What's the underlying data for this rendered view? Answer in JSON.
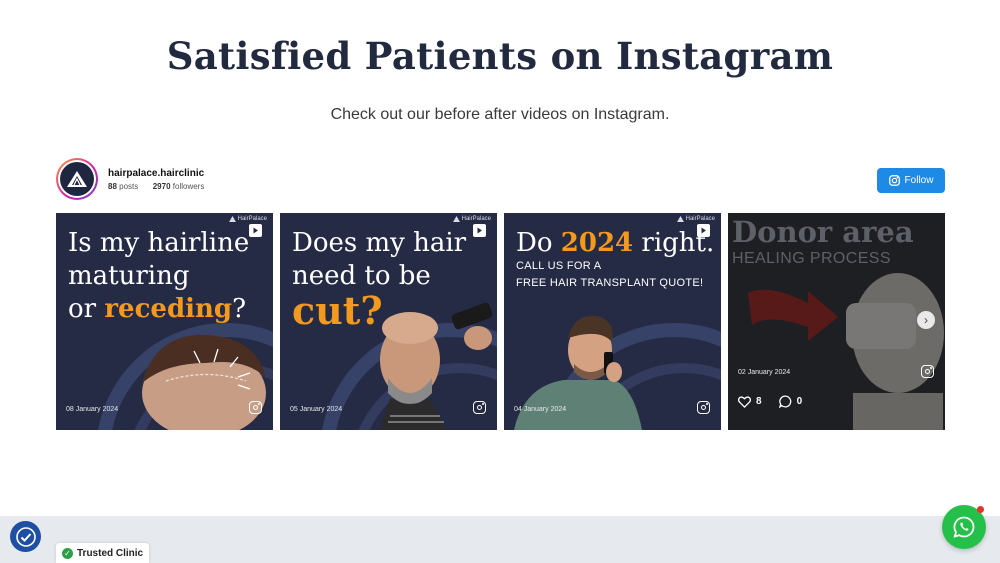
{
  "section": {
    "title": "Satisfied Patients on Instagram",
    "subtitle": "Check out our before after videos on Instagram."
  },
  "profile": {
    "username": "hairpalace.hairclinic",
    "posts_count": "88",
    "posts_label": "posts",
    "followers_count": "2970",
    "followers_label": "followers",
    "follow_label": "Follow"
  },
  "posts": [
    {
      "brand": "HairPalace",
      "line1": "Is my hairline",
      "line2": "maturing",
      "line3_a": "or ",
      "line3_b": "receding",
      "line3_c": "?",
      "date": "08 January 2024"
    },
    {
      "brand": "HairPalace",
      "line1": "Does my hair",
      "line2": "need to be",
      "line3": "cut?",
      "date": "05 January 2024"
    },
    {
      "brand": "HairPalace",
      "line1_a": "Do ",
      "line1_b": "2024",
      "line1_c": " right.",
      "line2": "CALL US FOR A",
      "line3": "FREE HAIR TRANSPLANT QUOTE!",
      "date": "04 January 2024"
    },
    {
      "title": "Donor area",
      "subtitle": "HEALING PROCESS",
      "date": "02 January 2024",
      "likes": "8",
      "comments": "0"
    }
  ],
  "widgets": {
    "trusted_label": "Trusted Clinic"
  },
  "colors": {
    "navy": "#262b45",
    "accent_orange": "#f39a1e",
    "follow_blue": "#1d8ae6",
    "whatsapp_green": "#25c04a"
  },
  "icons": [
    "instagram-icon",
    "play-icon",
    "heart-icon",
    "comment-icon",
    "whatsapp-icon",
    "accessibility-icon",
    "check-icon",
    "chevron-right-icon"
  ]
}
